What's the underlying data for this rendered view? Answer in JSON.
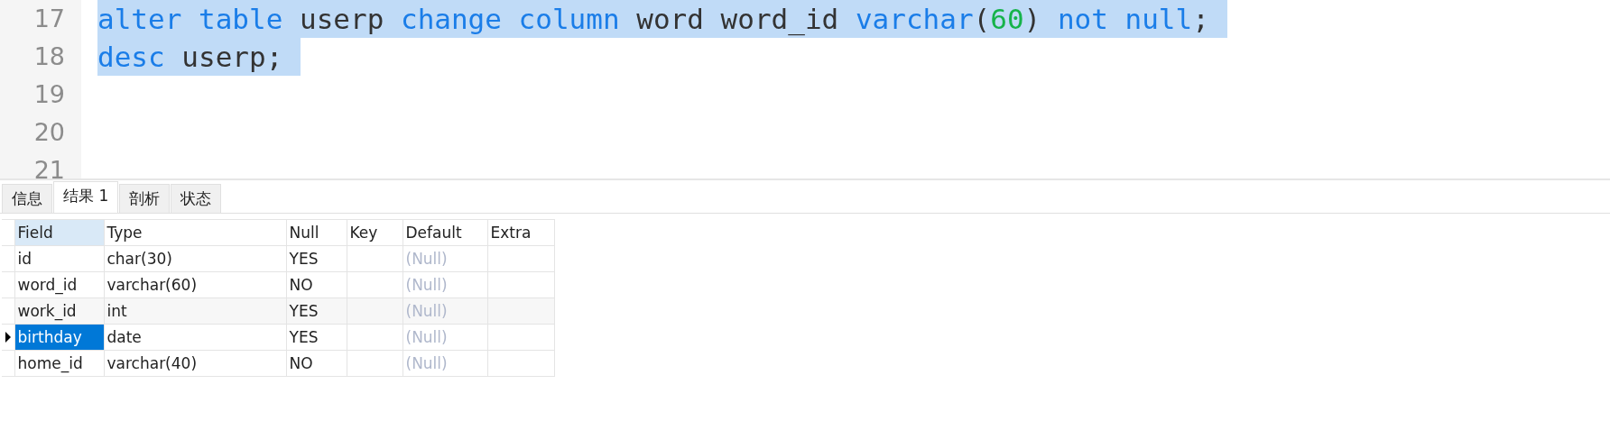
{
  "editor": {
    "lines": [
      {
        "number": "17",
        "selected": true,
        "tokens": [
          {
            "kind": "keyword",
            "text": "alter table"
          },
          {
            "kind": "plain",
            "text": " userp "
          },
          {
            "kind": "keyword",
            "text": "change column"
          },
          {
            "kind": "plain",
            "text": " word word_id "
          },
          {
            "kind": "keyword",
            "text": "varchar"
          },
          {
            "kind": "plain",
            "text": "("
          },
          {
            "kind": "number",
            "text": "60"
          },
          {
            "kind": "plain",
            "text": ") "
          },
          {
            "kind": "keyword",
            "text": "not null"
          },
          {
            "kind": "plain",
            "text": ";"
          }
        ]
      },
      {
        "number": "18",
        "selected": true,
        "tokens": [
          {
            "kind": "keyword",
            "text": "desc"
          },
          {
            "kind": "plain",
            "text": " userp;"
          }
        ]
      },
      {
        "number": "19"
      },
      {
        "number": "20"
      },
      {
        "number": "21"
      }
    ]
  },
  "tabs": [
    {
      "label": "信息",
      "selected": false
    },
    {
      "label": "结果 1",
      "selected": true
    },
    {
      "label": "剖析",
      "selected": false
    },
    {
      "label": "状态",
      "selected": false
    }
  ],
  "table": {
    "columns": [
      {
        "label": "Field",
        "selected": true
      },
      {
        "label": "Type",
        "selected": false
      },
      {
        "label": "Null",
        "selected": false
      },
      {
        "label": "Key",
        "selected": false
      },
      {
        "label": "Default",
        "selected": false
      },
      {
        "label": "Extra",
        "selected": false
      }
    ],
    "rows": [
      {
        "selected": false,
        "field": "id",
        "type": "char(30)",
        "null": "YES",
        "default": "(Null)",
        "default_is_null": true
      },
      {
        "selected": false,
        "field": "word_id",
        "type": "varchar(60)",
        "null": "NO",
        "default": "(Null)",
        "default_is_null": true
      },
      {
        "selected": false,
        "field": "work_id",
        "type": "int",
        "null": "YES",
        "default": "(Null)",
        "default_is_null": true
      },
      {
        "selected": true,
        "field": "birthday",
        "type": "date",
        "null": "YES",
        "default": "(Null)",
        "default_is_null": true
      },
      {
        "selected": false,
        "field": "home_id",
        "type": "varchar(40)",
        "null": "NO",
        "default": "(Null)",
        "default_is_null": true
      }
    ]
  }
}
